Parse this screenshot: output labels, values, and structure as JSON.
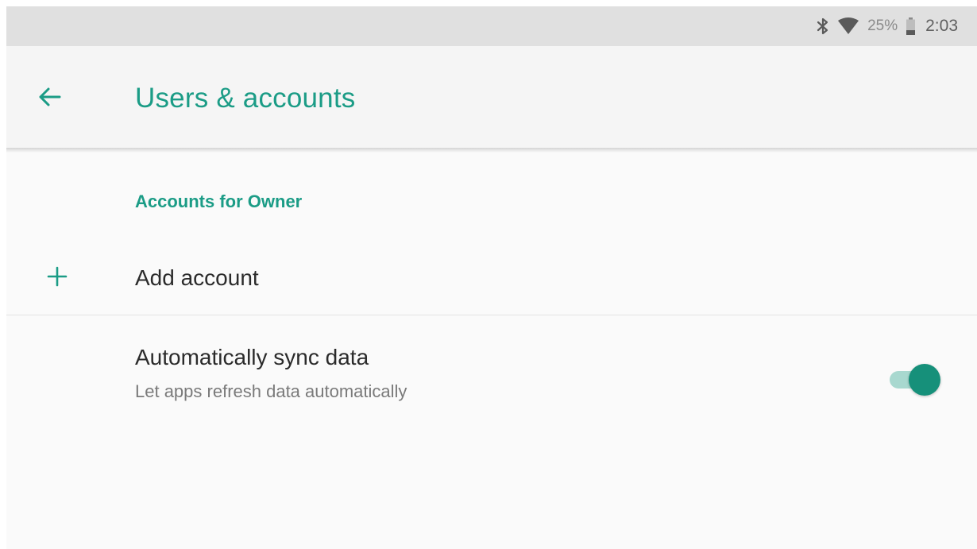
{
  "status_bar": {
    "icons": [
      "bluetooth-icon",
      "wifi-icon",
      "battery-icon"
    ],
    "battery_percent": "25%",
    "time": "2:03"
  },
  "app_bar": {
    "back_icon": "arrow-back-icon",
    "title": "Users & accounts"
  },
  "accounts": {
    "section_header": "Accounts for Owner",
    "add_account_icon": "plus-icon",
    "add_account_label": "Add account"
  },
  "sync": {
    "title": "Automatically sync data",
    "summary": "Let apps refresh data automatically",
    "enabled": true
  },
  "colors": {
    "accent": "#1b9c86",
    "toggle_thumb": "#16907a",
    "toggle_track": "#a8d8cf",
    "status_bar_bg": "#e0e0e0",
    "app_bar_bg": "#f5f5f5",
    "background": "#fafafa"
  }
}
